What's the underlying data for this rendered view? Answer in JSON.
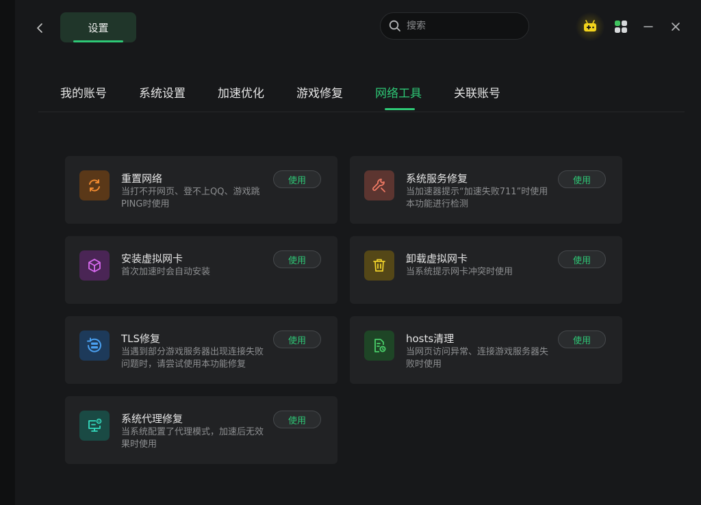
{
  "header": {
    "title": "设置",
    "search_placeholder": "搜索"
  },
  "tabs": [
    {
      "label": "我的账号"
    },
    {
      "label": "系统设置"
    },
    {
      "label": "加速优化"
    },
    {
      "label": "游戏修复"
    },
    {
      "label": "网络工具",
      "active": true
    },
    {
      "label": "关联账号"
    }
  ],
  "tools": [
    {
      "title": "重置网络",
      "desc": "当打不开网页、登不上QQ、游戏跳PING时使用",
      "button": "使用",
      "icon": "refresh-icon",
      "color": "#e07a2a"
    },
    {
      "title": "系统服务修复",
      "desc": "当加速器提示“加速失败711”时使用本功能进行检测",
      "button": "使用",
      "icon": "wrench-icon",
      "color": "#e0664f"
    },
    {
      "title": "安装虚拟网卡",
      "desc": "首次加速时会自动安装",
      "button": "使用",
      "icon": "cube-icon",
      "color": "#c25ae0"
    },
    {
      "title": "卸载虚拟网卡",
      "desc": "当系统提示网卡冲突时使用",
      "button": "使用",
      "icon": "trash-icon",
      "color": "#e0c21e"
    },
    {
      "title": "TLS修复",
      "desc": "当遇到部分游戏服务器出现连接失败问题时，请尝试使用本功能修复",
      "button": "使用",
      "icon": "server-refresh-icon",
      "color": "#3a8fe0"
    },
    {
      "title": "hosts清理",
      "desc": "当网页访问异常、连接游戏服务器失败时使用",
      "button": "使用",
      "icon": "document-clean-icon",
      "color": "#3fc35e"
    },
    {
      "title": "系统代理修复",
      "desc": "当系统配置了代理模式，加速后无效果时使用",
      "button": "使用",
      "icon": "monitor-settings-icon",
      "color": "#2ed3b8"
    }
  ]
}
